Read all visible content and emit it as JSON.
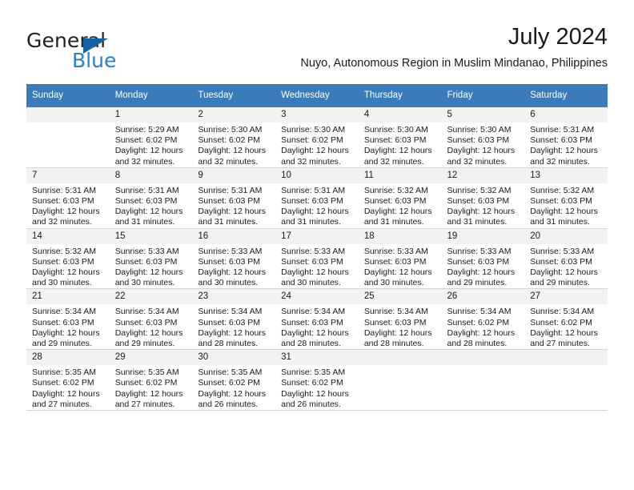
{
  "logo": {
    "word_one": "General",
    "word_two": "Blue",
    "mark": "triangle-mark"
  },
  "header": {
    "title": "July 2024",
    "subtitle": "Nuyo, Autonomous Region in Muslim Mindanao, Philippines"
  },
  "colors": {
    "header_band": "#3a7cb9",
    "daynum_band": "#f2f2f2",
    "logo_blue": "#2980c4",
    "logo_mark": "#1464a5",
    "text": "#1a1a1a"
  },
  "calendar": {
    "weekday_headers": [
      "Sunday",
      "Monday",
      "Tuesday",
      "Wednesday",
      "Thursday",
      "Friday",
      "Saturday"
    ],
    "weeks": [
      [
        {
          "day": "",
          "sunrise": "",
          "sunset": "",
          "daylight_line1": "",
          "daylight_line2": "",
          "empty": true
        },
        {
          "day": "1",
          "sunrise": "Sunrise: 5:29 AM",
          "sunset": "Sunset: 6:02 PM",
          "daylight_line1": "Daylight: 12 hours",
          "daylight_line2": "and 32 minutes."
        },
        {
          "day": "2",
          "sunrise": "Sunrise: 5:30 AM",
          "sunset": "Sunset: 6:02 PM",
          "daylight_line1": "Daylight: 12 hours",
          "daylight_line2": "and 32 minutes."
        },
        {
          "day": "3",
          "sunrise": "Sunrise: 5:30 AM",
          "sunset": "Sunset: 6:02 PM",
          "daylight_line1": "Daylight: 12 hours",
          "daylight_line2": "and 32 minutes."
        },
        {
          "day": "4",
          "sunrise": "Sunrise: 5:30 AM",
          "sunset": "Sunset: 6:03 PM",
          "daylight_line1": "Daylight: 12 hours",
          "daylight_line2": "and 32 minutes."
        },
        {
          "day": "5",
          "sunrise": "Sunrise: 5:30 AM",
          "sunset": "Sunset: 6:03 PM",
          "daylight_line1": "Daylight: 12 hours",
          "daylight_line2": "and 32 minutes."
        },
        {
          "day": "6",
          "sunrise": "Sunrise: 5:31 AM",
          "sunset": "Sunset: 6:03 PM",
          "daylight_line1": "Daylight: 12 hours",
          "daylight_line2": "and 32 minutes."
        }
      ],
      [
        {
          "day": "7",
          "sunrise": "Sunrise: 5:31 AM",
          "sunset": "Sunset: 6:03 PM",
          "daylight_line1": "Daylight: 12 hours",
          "daylight_line2": "and 32 minutes."
        },
        {
          "day": "8",
          "sunrise": "Sunrise: 5:31 AM",
          "sunset": "Sunset: 6:03 PM",
          "daylight_line1": "Daylight: 12 hours",
          "daylight_line2": "and 31 minutes."
        },
        {
          "day": "9",
          "sunrise": "Sunrise: 5:31 AM",
          "sunset": "Sunset: 6:03 PM",
          "daylight_line1": "Daylight: 12 hours",
          "daylight_line2": "and 31 minutes."
        },
        {
          "day": "10",
          "sunrise": "Sunrise: 5:31 AM",
          "sunset": "Sunset: 6:03 PM",
          "daylight_line1": "Daylight: 12 hours",
          "daylight_line2": "and 31 minutes."
        },
        {
          "day": "11",
          "sunrise": "Sunrise: 5:32 AM",
          "sunset": "Sunset: 6:03 PM",
          "daylight_line1": "Daylight: 12 hours",
          "daylight_line2": "and 31 minutes."
        },
        {
          "day": "12",
          "sunrise": "Sunrise: 5:32 AM",
          "sunset": "Sunset: 6:03 PM",
          "daylight_line1": "Daylight: 12 hours",
          "daylight_line2": "and 31 minutes."
        },
        {
          "day": "13",
          "sunrise": "Sunrise: 5:32 AM",
          "sunset": "Sunset: 6:03 PM",
          "daylight_line1": "Daylight: 12 hours",
          "daylight_line2": "and 31 minutes."
        }
      ],
      [
        {
          "day": "14",
          "sunrise": "Sunrise: 5:32 AM",
          "sunset": "Sunset: 6:03 PM",
          "daylight_line1": "Daylight: 12 hours",
          "daylight_line2": "and 30 minutes."
        },
        {
          "day": "15",
          "sunrise": "Sunrise: 5:33 AM",
          "sunset": "Sunset: 6:03 PM",
          "daylight_line1": "Daylight: 12 hours",
          "daylight_line2": "and 30 minutes."
        },
        {
          "day": "16",
          "sunrise": "Sunrise: 5:33 AM",
          "sunset": "Sunset: 6:03 PM",
          "daylight_line1": "Daylight: 12 hours",
          "daylight_line2": "and 30 minutes."
        },
        {
          "day": "17",
          "sunrise": "Sunrise: 5:33 AM",
          "sunset": "Sunset: 6:03 PM",
          "daylight_line1": "Daylight: 12 hours",
          "daylight_line2": "and 30 minutes."
        },
        {
          "day": "18",
          "sunrise": "Sunrise: 5:33 AM",
          "sunset": "Sunset: 6:03 PM",
          "daylight_line1": "Daylight: 12 hours",
          "daylight_line2": "and 30 minutes."
        },
        {
          "day": "19",
          "sunrise": "Sunrise: 5:33 AM",
          "sunset": "Sunset: 6:03 PM",
          "daylight_line1": "Daylight: 12 hours",
          "daylight_line2": "and 29 minutes."
        },
        {
          "day": "20",
          "sunrise": "Sunrise: 5:33 AM",
          "sunset": "Sunset: 6:03 PM",
          "daylight_line1": "Daylight: 12 hours",
          "daylight_line2": "and 29 minutes."
        }
      ],
      [
        {
          "day": "21",
          "sunrise": "Sunrise: 5:34 AM",
          "sunset": "Sunset: 6:03 PM",
          "daylight_line1": "Daylight: 12 hours",
          "daylight_line2": "and 29 minutes."
        },
        {
          "day": "22",
          "sunrise": "Sunrise: 5:34 AM",
          "sunset": "Sunset: 6:03 PM",
          "daylight_line1": "Daylight: 12 hours",
          "daylight_line2": "and 29 minutes."
        },
        {
          "day": "23",
          "sunrise": "Sunrise: 5:34 AM",
          "sunset": "Sunset: 6:03 PM",
          "daylight_line1": "Daylight: 12 hours",
          "daylight_line2": "and 28 minutes."
        },
        {
          "day": "24",
          "sunrise": "Sunrise: 5:34 AM",
          "sunset": "Sunset: 6:03 PM",
          "daylight_line1": "Daylight: 12 hours",
          "daylight_line2": "and 28 minutes."
        },
        {
          "day": "25",
          "sunrise": "Sunrise: 5:34 AM",
          "sunset": "Sunset: 6:03 PM",
          "daylight_line1": "Daylight: 12 hours",
          "daylight_line2": "and 28 minutes."
        },
        {
          "day": "26",
          "sunrise": "Sunrise: 5:34 AM",
          "sunset": "Sunset: 6:02 PM",
          "daylight_line1": "Daylight: 12 hours",
          "daylight_line2": "and 28 minutes."
        },
        {
          "day": "27",
          "sunrise": "Sunrise: 5:34 AM",
          "sunset": "Sunset: 6:02 PM",
          "daylight_line1": "Daylight: 12 hours",
          "daylight_line2": "and 27 minutes."
        }
      ],
      [
        {
          "day": "28",
          "sunrise": "Sunrise: 5:35 AM",
          "sunset": "Sunset: 6:02 PM",
          "daylight_line1": "Daylight: 12 hours",
          "daylight_line2": "and 27 minutes."
        },
        {
          "day": "29",
          "sunrise": "Sunrise: 5:35 AM",
          "sunset": "Sunset: 6:02 PM",
          "daylight_line1": "Daylight: 12 hours",
          "daylight_line2": "and 27 minutes."
        },
        {
          "day": "30",
          "sunrise": "Sunrise: 5:35 AM",
          "sunset": "Sunset: 6:02 PM",
          "daylight_line1": "Daylight: 12 hours",
          "daylight_line2": "and 26 minutes."
        },
        {
          "day": "31",
          "sunrise": "Sunrise: 5:35 AM",
          "sunset": "Sunset: 6:02 PM",
          "daylight_line1": "Daylight: 12 hours",
          "daylight_line2": "and 26 minutes."
        },
        {
          "day": "",
          "sunrise": "",
          "sunset": "",
          "daylight_line1": "",
          "daylight_line2": "",
          "empty": true
        },
        {
          "day": "",
          "sunrise": "",
          "sunset": "",
          "daylight_line1": "",
          "daylight_line2": "",
          "empty": true
        },
        {
          "day": "",
          "sunrise": "",
          "sunset": "",
          "daylight_line1": "",
          "daylight_line2": "",
          "empty": true
        }
      ]
    ]
  }
}
